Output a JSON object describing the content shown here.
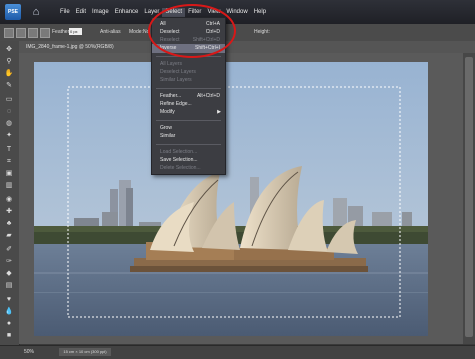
{
  "app": {
    "logo": "PSE"
  },
  "menubar": {
    "items": [
      "File",
      "Edit",
      "Image",
      "Enhance",
      "Layer",
      "Select",
      "Filter",
      "View",
      "Window",
      "Help"
    ]
  },
  "options": {
    "feather_label": "Feather:",
    "feather_value": "0 px",
    "anti_alias": "Anti-alias",
    "mode": "Mode:",
    "mode_value": "No",
    "height_label": "Height:"
  },
  "document": {
    "tab_title": "IMG_2840_frame-1.jpg @ 50%(RGB/8)"
  },
  "status": {
    "zoom": "50%",
    "size": "15 cm × 10 cm (300 ppi)"
  },
  "select_menu": {
    "items": [
      {
        "label": "All",
        "shortcut": "Ctrl+A",
        "state": "enabled"
      },
      {
        "label": "Deselect",
        "shortcut": "Ctrl+D",
        "state": "enabled"
      },
      {
        "label": "Reselect",
        "shortcut": "Shift+Ctrl+D",
        "state": "disabled"
      },
      {
        "label": "Inverse",
        "shortcut": "Shift+Ctrl+I",
        "state": "highlight"
      },
      {
        "label": "All Layers",
        "shortcut": "",
        "state": "disabled"
      },
      {
        "label": "Deselect Layers",
        "shortcut": "",
        "state": "disabled"
      },
      {
        "label": "Similar Layers",
        "shortcut": "",
        "state": "disabled"
      },
      {
        "label": "Feather...",
        "shortcut": "Alt+Ctrl+D",
        "state": "enabled"
      },
      {
        "label": "Refine Edge...",
        "shortcut": "",
        "state": "enabled"
      },
      {
        "label": "Modify",
        "shortcut": "",
        "state": "enabled"
      },
      {
        "label": "Grow",
        "shortcut": "",
        "state": "enabled"
      },
      {
        "label": "Similar",
        "shortcut": "",
        "state": "enabled"
      },
      {
        "label": "Load Selection...",
        "shortcut": "",
        "state": "disabled"
      },
      {
        "label": "Save Selection...",
        "shortcut": "",
        "state": "enabled"
      },
      {
        "label": "Delete Selection...",
        "shortcut": "",
        "state": "disabled"
      }
    ],
    "submenu_arrow": "▶"
  },
  "colors": {
    "accent": "#d81818",
    "menu_bg": "#3c3d42",
    "highlight": "#6e7080"
  },
  "tools": [
    "move-tool",
    "zoom-tool",
    "hand-tool",
    "eyedropper-tool",
    "marquee-tool",
    "lasso-tool",
    "quick-selection-tool",
    "magic-wand-tool",
    "type-tool",
    "crop-tool",
    "recompose-tool",
    "straighten-tool",
    "red-eye-tool",
    "spot-healing-tool",
    "clone-stamp-tool",
    "eraser-tool",
    "brush-tool",
    "smart-brush-tool",
    "paint-bucket-tool",
    "gradient-tool",
    "shape-tool",
    "blur-tool",
    "sponge-tool",
    "foreground-color-swatch"
  ]
}
